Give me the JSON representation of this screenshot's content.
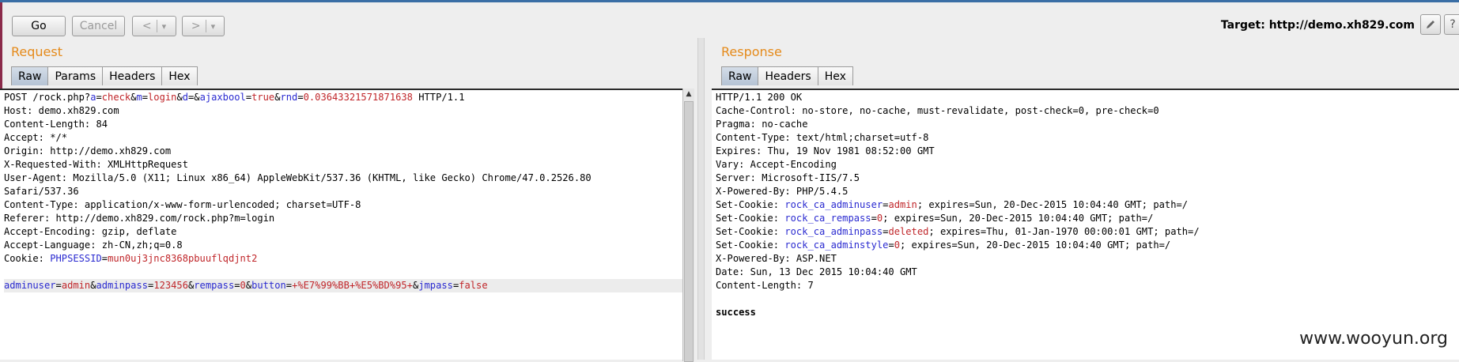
{
  "toolbar": {
    "go_label": "Go",
    "cancel_label": "Cancel",
    "back_label": "<",
    "back_menu": "▾",
    "forward_label": ">",
    "forward_menu": "▾",
    "target_prefix": "Target:",
    "target_url": "http://demo.xh829.com"
  },
  "request": {
    "title": "Request",
    "tabs": [
      "Raw",
      "Params",
      "Headers",
      "Hex"
    ],
    "active_tab": "Raw",
    "lines": [
      [
        {
          "t": "POST /rock.php?"
        },
        {
          "t": "a",
          "c": "k"
        },
        {
          "t": "="
        },
        {
          "t": "check",
          "c": "v"
        },
        {
          "t": "&"
        },
        {
          "t": "m",
          "c": "k"
        },
        {
          "t": "="
        },
        {
          "t": "login",
          "c": "v"
        },
        {
          "t": "&"
        },
        {
          "t": "d",
          "c": "k"
        },
        {
          "t": "=&"
        },
        {
          "t": "ajaxbool",
          "c": "k"
        },
        {
          "t": "="
        },
        {
          "t": "true",
          "c": "v"
        },
        {
          "t": "&"
        },
        {
          "t": "rnd",
          "c": "k"
        },
        {
          "t": "="
        },
        {
          "t": "0.03643321571871638",
          "c": "v"
        },
        {
          "t": " HTTP/1.1"
        }
      ],
      [
        {
          "t": "Host: demo.xh829.com"
        }
      ],
      [
        {
          "t": "Content-Length: 84"
        }
      ],
      [
        {
          "t": "Accept: */*"
        }
      ],
      [
        {
          "t": "Origin: http://demo.xh829.com"
        }
      ],
      [
        {
          "t": "X-Requested-With: XMLHttpRequest"
        }
      ],
      [
        {
          "t": "User-Agent: Mozilla/5.0 (X11; Linux x86_64) AppleWebKit/537.36 (KHTML, like Gecko) Chrome/47.0.2526.80"
        }
      ],
      [
        {
          "t": "Safari/537.36"
        }
      ],
      [
        {
          "t": "Content-Type: application/x-www-form-urlencoded; charset=UTF-8"
        }
      ],
      [
        {
          "t": "Referer: http://demo.xh829.com/rock.php?m=login"
        }
      ],
      [
        {
          "t": "Accept-Encoding: gzip, deflate"
        }
      ],
      [
        {
          "t": "Accept-Language: zh-CN,zh;q=0.8"
        }
      ],
      [
        {
          "t": "Cookie: "
        },
        {
          "t": "PHPSESSID",
          "c": "k"
        },
        {
          "t": "="
        },
        {
          "t": "mun0uj3jnc8368pbuuflqdjnt2",
          "c": "v"
        }
      ],
      [
        {
          "t": ""
        }
      ],
      [
        {
          "t": "adminuser",
          "c": "k"
        },
        {
          "t": "="
        },
        {
          "t": "admin",
          "c": "v"
        },
        {
          "t": "&"
        },
        {
          "t": "adminpass",
          "c": "k"
        },
        {
          "t": "="
        },
        {
          "t": "123456",
          "c": "v"
        },
        {
          "t": "&"
        },
        {
          "t": "rempass",
          "c": "k"
        },
        {
          "t": "="
        },
        {
          "t": "0",
          "c": "v"
        },
        {
          "t": "&"
        },
        {
          "t": "button",
          "c": "k"
        },
        {
          "t": "="
        },
        {
          "t": "+%E7%99%BB+%E5%BD%95+",
          "c": "v"
        },
        {
          "t": "&"
        },
        {
          "t": "jmpass",
          "c": "k"
        },
        {
          "t": "="
        },
        {
          "t": "false",
          "c": "v"
        }
      ]
    ],
    "highlighted_line": 14
  },
  "response": {
    "title": "Response",
    "tabs": [
      "Raw",
      "Headers",
      "Hex"
    ],
    "active_tab": "Raw",
    "lines": [
      [
        {
          "t": "HTTP/1.1 200 OK"
        }
      ],
      [
        {
          "t": "Cache-Control: no-store, no-cache, must-revalidate, post-check=0, pre-check=0"
        }
      ],
      [
        {
          "t": "Pragma: no-cache"
        }
      ],
      [
        {
          "t": "Content-Type: text/html;charset=utf-8"
        }
      ],
      [
        {
          "t": "Expires: Thu, 19 Nov 1981 08:52:00 GMT"
        }
      ],
      [
        {
          "t": "Vary: Accept-Encoding"
        }
      ],
      [
        {
          "t": "Server: Microsoft-IIS/7.5"
        }
      ],
      [
        {
          "t": "X-Powered-By: PHP/5.4.5"
        }
      ],
      [
        {
          "t": "Set-Cookie: "
        },
        {
          "t": "rock_ca_adminuser",
          "c": "k"
        },
        {
          "t": "="
        },
        {
          "t": "admin",
          "c": "v"
        },
        {
          "t": "; expires=Sun, 20-Dec-2015 10:04:40 GMT; path=/"
        }
      ],
      [
        {
          "t": "Set-Cookie: "
        },
        {
          "t": "rock_ca_rempass",
          "c": "k"
        },
        {
          "t": "="
        },
        {
          "t": "0",
          "c": "v"
        },
        {
          "t": "; expires=Sun, 20-Dec-2015 10:04:40 GMT; path=/"
        }
      ],
      [
        {
          "t": "Set-Cookie: "
        },
        {
          "t": "rock_ca_adminpass",
          "c": "k"
        },
        {
          "t": "="
        },
        {
          "t": "deleted",
          "c": "v"
        },
        {
          "t": "; expires=Thu, 01-Jan-1970 00:00:01 GMT; path=/"
        }
      ],
      [
        {
          "t": "Set-Cookie: "
        },
        {
          "t": "rock_ca_adminstyle",
          "c": "k"
        },
        {
          "t": "="
        },
        {
          "t": "0",
          "c": "v"
        },
        {
          "t": "; expires=Sun, 20-Dec-2015 10:04:40 GMT; path=/"
        }
      ],
      [
        {
          "t": "X-Powered-By: ASP.NET"
        }
      ],
      [
        {
          "t": "Date: Sun, 13 Dec 2015 10:04:40 GMT"
        }
      ],
      [
        {
          "t": "Content-Length: 7"
        }
      ],
      [
        {
          "t": ""
        }
      ],
      [
        {
          "t": "success",
          "c": "bold"
        }
      ]
    ]
  },
  "icons": {
    "edit": "pencil-icon",
    "help": "help-icon"
  },
  "watermark": "www.wooyun.org"
}
